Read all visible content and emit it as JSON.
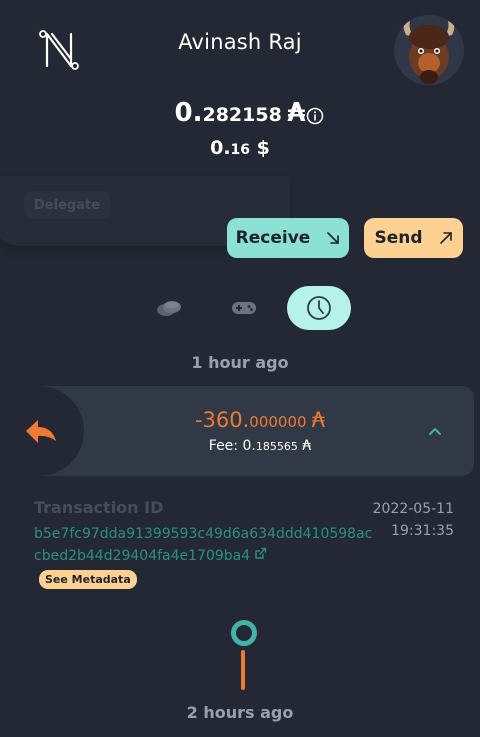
{
  "header": {
    "username": "Avinash Raj"
  },
  "balance": {
    "whole": "0.",
    "fraction": "282158",
    "currency_symbol": "₳",
    "usd_whole": "0.",
    "usd_fraction": "16",
    "usd_symbol": "$"
  },
  "actions": {
    "delegate_label": "Delegate",
    "receive_label": "Receive",
    "send_label": "Send"
  },
  "tabs": [
    {
      "name": "assets",
      "icon": "coins-icon",
      "active": false
    },
    {
      "name": "collectibles",
      "icon": "gamepad-icon",
      "active": false
    },
    {
      "name": "history",
      "icon": "clock-icon",
      "active": true
    }
  ],
  "history": {
    "group_1_label": "1 hour ago",
    "group_2_label": "2 hours ago",
    "transaction": {
      "amount_whole": "-360.",
      "amount_fraction": "000000",
      "amount_symbol": "₳",
      "fee_label": "Fee: 0.",
      "fee_fraction": "185565",
      "fee_symbol": "₳",
      "id_label": "Transaction ID",
      "id_line_1": "b5e7fc97dda91399593c49d6a634ddd410598ac",
      "id_line_2": "cbed2b44d29404fa4e1709ba4",
      "date": "2022-05-11",
      "time": "19:31:35",
      "metadata_label": "See Metadata"
    }
  },
  "colors": {
    "background": "#232834",
    "receive": "#8ae1d4",
    "send": "#fcd191",
    "outgoing": "#f07a31",
    "link": "#2a8f86"
  }
}
